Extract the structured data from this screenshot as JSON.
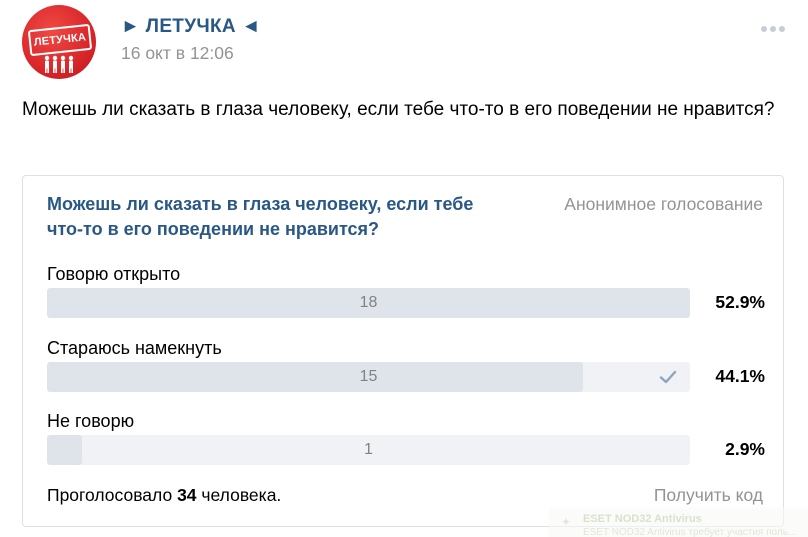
{
  "post": {
    "author": "► ЛЕТУЧКА ◄",
    "date": "16 окт в 12:06",
    "text": "Можешь ли сказать в глаза человеку, если тебе что-то в его поведении не нравится?",
    "avatar_text": "ЛЕТУЧКА",
    "more_icon": "more-horizontal-icon"
  },
  "poll": {
    "question": "Можешь ли сказать в глаза человеку, если тебе что-то в его поведении не нравится?",
    "type": "Анонимное голосование",
    "options": [
      {
        "label": "Говорю открыто",
        "count": "18",
        "percent": "52.9%",
        "fraction": 0.529,
        "voted": false
      },
      {
        "label": "Стараюсь намекнуть",
        "count": "15",
        "percent": "44.1%",
        "fraction": 0.441,
        "voted": true
      },
      {
        "label": "Не говорю",
        "count": "1",
        "percent": "2.9%",
        "fraction": 0.029,
        "voted": false
      }
    ],
    "footer_prefix": "Проголосовало",
    "total_votes": "34",
    "footer_suffix": "человека.",
    "get_code": "Получить код",
    "check_icon": "checkmark-icon"
  },
  "notification": {
    "title": "ESET NOD32 Antivirus",
    "subtitle": "ESET NOD32 Antivirus требует участия поль..."
  },
  "colors": {
    "link": "#2a5885",
    "muted": "#939393",
    "bar_track": "#f0f2f5",
    "bar_fill": "#dfe4eb",
    "avatar_red": "#d9262a"
  }
}
